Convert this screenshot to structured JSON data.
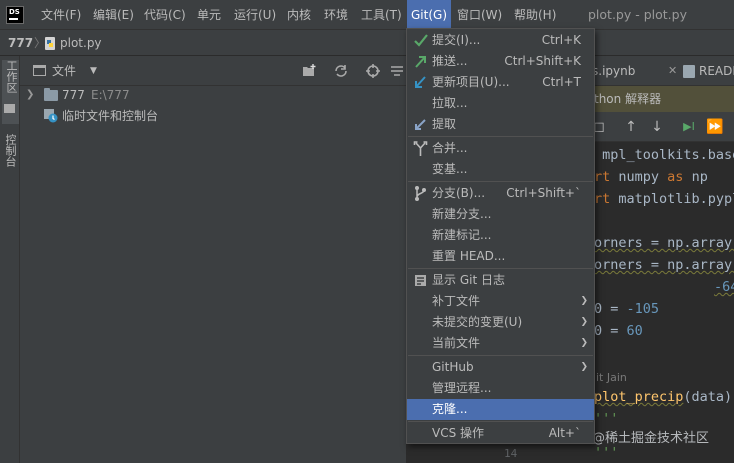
{
  "menubar": {
    "logo": "DS",
    "items": [
      "文件(F)",
      "编辑(E)",
      "代码(C)",
      "单元",
      "运行(U)",
      "内核",
      "环境",
      "工具(T)",
      "Git(G)",
      "窗口(W)",
      "帮助(H)"
    ],
    "window_title": "plot.py - plot.py"
  },
  "navbar": {
    "project": "777",
    "file": "plot.py"
  },
  "left_strip": {
    "project_tab": "工作区",
    "second_tab": "控制台"
  },
  "project_panel": {
    "title": "文件",
    "tree": {
      "project_name": "777",
      "project_path": "E:\\777",
      "scratch_label": "临时文件和控制台"
    }
  },
  "editor": {
    "tabs": [
      "s.ipynb",
      "READMI"
    ],
    "banner_text": "thon 解释器",
    "code": {
      "line1_a": " mpl_toolkits.base",
      "line2_kw": "rt",
      "line2_rest": " numpy ",
      "line2_as": "as",
      "line2_np": " np",
      "line3_kw": "rt",
      "line3_rest": " matplotlib.pyplo",
      "line4": "orners = np.array(",
      "line5": "orners = np.array(",
      "line6": "-64",
      "line7_a": "0 = ",
      "line7_num": "-105",
      "line8_a": "0 = ",
      "line8_num": "60",
      "author": "it Jain",
      "line9_fn": "plot_precip",
      "line9_rest": "(data)",
      "line10": "'''",
      "line11": "'''",
      "line_number": "14"
    }
  },
  "watermark": "@稀土掘金技术社区",
  "git_menu": {
    "items": [
      {
        "label": "提交(I)...",
        "shortcut": "Ctrl+K"
      },
      {
        "label": "推送...",
        "shortcut": "Ctrl+Shift+K"
      },
      {
        "label": "更新项目(U)...",
        "shortcut": "Ctrl+T"
      },
      {
        "label": "拉取..."
      },
      {
        "label": "提取"
      },
      {
        "label": "合并..."
      },
      {
        "label": "变基..."
      },
      {
        "label": "分支(B)...",
        "shortcut": "Ctrl+Shift+`"
      },
      {
        "label": "新建分支..."
      },
      {
        "label": "新建标记..."
      },
      {
        "label": "重置 HEAD..."
      },
      {
        "label": "显示 Git 日志"
      },
      {
        "label": "补丁文件"
      },
      {
        "label": "未提交的变更(U)"
      },
      {
        "label": "当前文件"
      },
      {
        "label": "GitHub"
      },
      {
        "label": "管理远程..."
      },
      {
        "label": "克隆..."
      },
      {
        "label": "VCS 操作",
        "shortcut": "Alt+`"
      }
    ]
  },
  "colors": {
    "accent": "#4b6eaf",
    "commit_check": "#59a869",
    "push_arrow": "#59a869",
    "update_arrow": "#3592c4",
    "banner": "#52503a"
  }
}
